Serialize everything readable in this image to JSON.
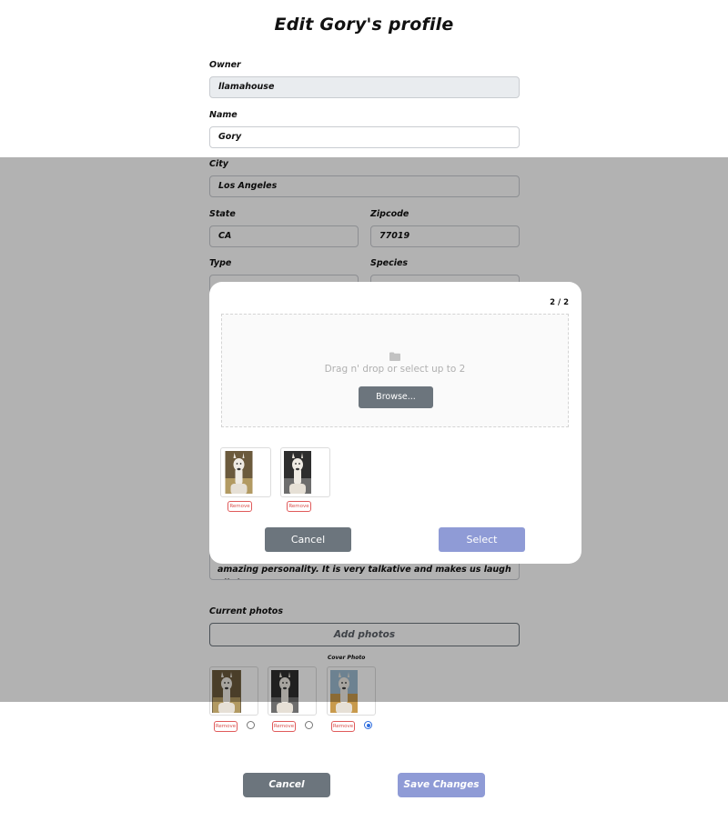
{
  "form": {
    "title": "Edit Gory's profile",
    "owner": {
      "label": "Owner",
      "value": "llamahouse"
    },
    "name": {
      "label": "Name",
      "value": "Gory"
    },
    "city": {
      "label": "City",
      "value": "Los Angeles"
    },
    "state": {
      "label": "State",
      "value": "CA"
    },
    "zipcode": {
      "label": "Zipcode",
      "value": "77019"
    },
    "type": {
      "label": "Type",
      "value": ""
    },
    "species": {
      "label": "Species",
      "value": ""
    },
    "about": {
      "line1": "amazing personality.  It is very talkative and makes us laugh all the"
    },
    "current_photos": {
      "label": "Current photos",
      "add_label": "Add photos",
      "cover_label": "Cover Photo",
      "remove_label": "Remove",
      "photos": [
        {
          "name": "llama-brown",
          "is_cover": false
        },
        {
          "name": "llama-bw",
          "is_cover": false
        },
        {
          "name": "llama-field",
          "is_cover": true
        }
      ]
    },
    "cancel_label": "Cancel",
    "save_label": "Save Changes"
  },
  "modal": {
    "counter": "2 / 2",
    "drop_text": "Drag n' drop or select up to 2",
    "browse_label": "Browse...",
    "remove_label": "Remove",
    "cancel_label": "Cancel",
    "select_label": "Select",
    "icon": "folder-icon"
  },
  "colors": {
    "secondary": "#6c757d",
    "primary_disabled": "#8f9bd6",
    "danger": "#d9534f",
    "radio_selected": "#2d6cdf",
    "readonly_bg": "#e9ecef"
  }
}
